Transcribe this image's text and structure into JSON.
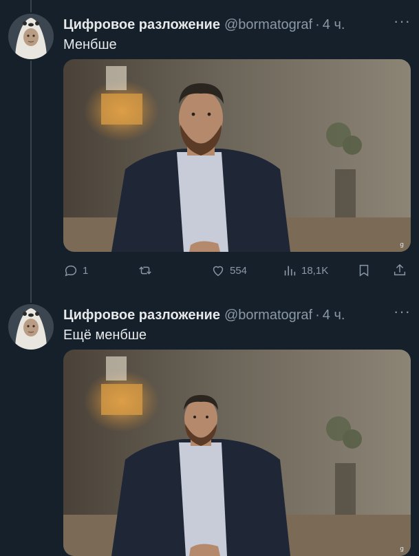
{
  "tweets": [
    {
      "author_name": "Цифровое разложение",
      "handle": "@bormatograf",
      "time": "4 ч.",
      "text": "Менбше",
      "more": "···",
      "actions": {
        "replies": "1",
        "retweets": "",
        "likes": "554",
        "views": "18,1K"
      }
    },
    {
      "author_name": "Цифровое разложение",
      "handle": "@bormatograf",
      "time": "4 ч.",
      "text": "Ещё менбше",
      "more": "···"
    }
  ],
  "icons": [
    "reply-icon",
    "retweet-icon",
    "like-icon",
    "views-icon",
    "bookmark-icon",
    "share-icon"
  ],
  "colors": {
    "background": "#15202b",
    "text": "#e7e9ea",
    "muted": "#8b98a5",
    "thread_line": "#38444d"
  }
}
